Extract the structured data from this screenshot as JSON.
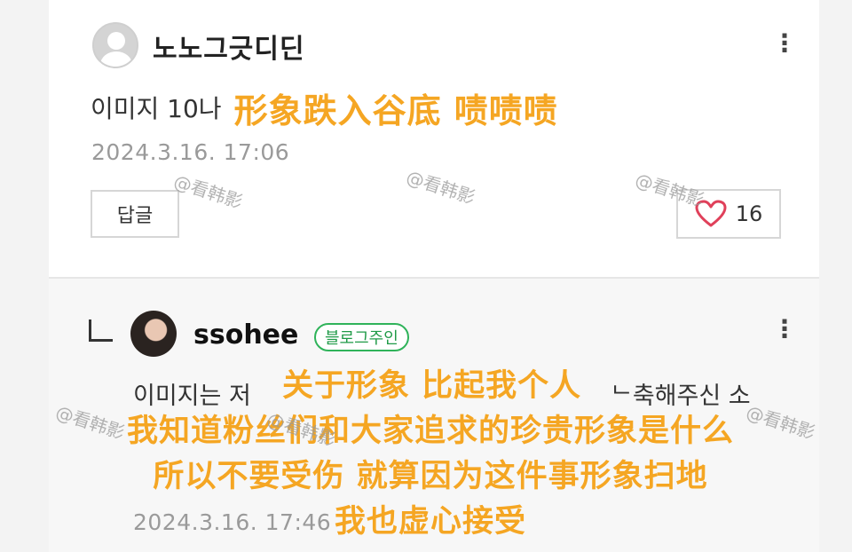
{
  "top_comment": {
    "username": "노노그긋디딘",
    "text_korean": "이미지 10나",
    "overlay_chinese": "形象跌入谷底 啧啧啧",
    "timestamp": "2024.3.16. 17:06",
    "reply_button_label": "답글",
    "like_count": "16",
    "more_menu": "⋮"
  },
  "reply_comment": {
    "username": "ssohee",
    "badge": "블로그주인",
    "text_korean_start": "이미지는 저",
    "text_korean_end": "ᄂ축해주신 소",
    "timestamp": "2024.3.16. 17:46",
    "more_menu": "⋮",
    "subtitles": [
      "关于形象 比起我个人",
      "我知道粉丝们和大家追求的珍贵形象是什么",
      "所以不要受伤 就算因为这件事形象扫地",
      "我也虚心接受"
    ]
  },
  "watermarks": [
    "@看韩影",
    "@看韩影",
    "@看韩影",
    "@看韩影",
    "@看韩影",
    "@看韩影"
  ],
  "colors": {
    "subtitle": "#f5a623",
    "badge_green": "#2fb35a",
    "heart_red": "#e0405a"
  }
}
